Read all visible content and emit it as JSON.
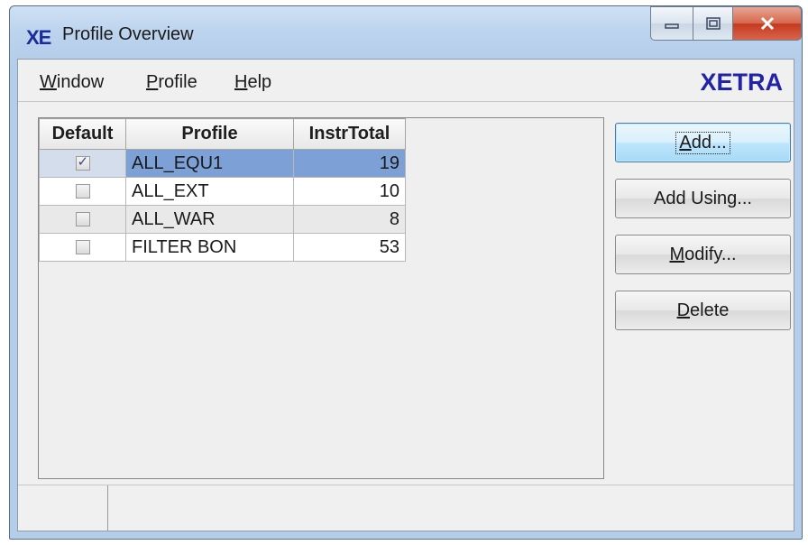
{
  "window": {
    "logo": "XE",
    "title": "Profile Overview"
  },
  "menu": {
    "items": [
      {
        "label": "Window",
        "mnemonic": "W",
        "rest": "indow"
      },
      {
        "label": "Profile",
        "mnemonic": "P",
        "rest": "rofile"
      },
      {
        "label": "Help",
        "mnemonic": "H",
        "rest": "elp"
      }
    ],
    "brand": "XETRA"
  },
  "table": {
    "columns": [
      "Default",
      "Profile",
      "InstrTotal"
    ],
    "rows": [
      {
        "default": true,
        "profile": "ALL_EQU1",
        "instr_total": "19",
        "selected": true
      },
      {
        "default": false,
        "profile": "ALL_EXT",
        "instr_total": "10",
        "selected": false
      },
      {
        "default": false,
        "profile": "ALL_WAR",
        "instr_total": "8",
        "selected": false
      },
      {
        "default": false,
        "profile": "FILTER BON",
        "instr_total": "53",
        "selected": false
      }
    ]
  },
  "buttons": {
    "add": {
      "pre": "",
      "mnemonic": "A",
      "post": "dd..."
    },
    "add_using": {
      "pre": "Add Usin",
      "mnemonic": "g",
      "post": "..."
    },
    "modify": {
      "pre": "",
      "mnemonic": "M",
      "post": "odify..."
    },
    "delete": {
      "pre": "",
      "mnemonic": "D",
      "post": "elete"
    }
  },
  "icons": {
    "minimize": "minimize-icon",
    "maximize": "maximize-icon",
    "close": "close-icon",
    "checkbox_checked": "checkbox-checked-icon",
    "checkbox_unchecked": "checkbox-unchecked-icon"
  },
  "colors": {
    "selection": "#7da1d7",
    "brand": "#2224a8"
  }
}
